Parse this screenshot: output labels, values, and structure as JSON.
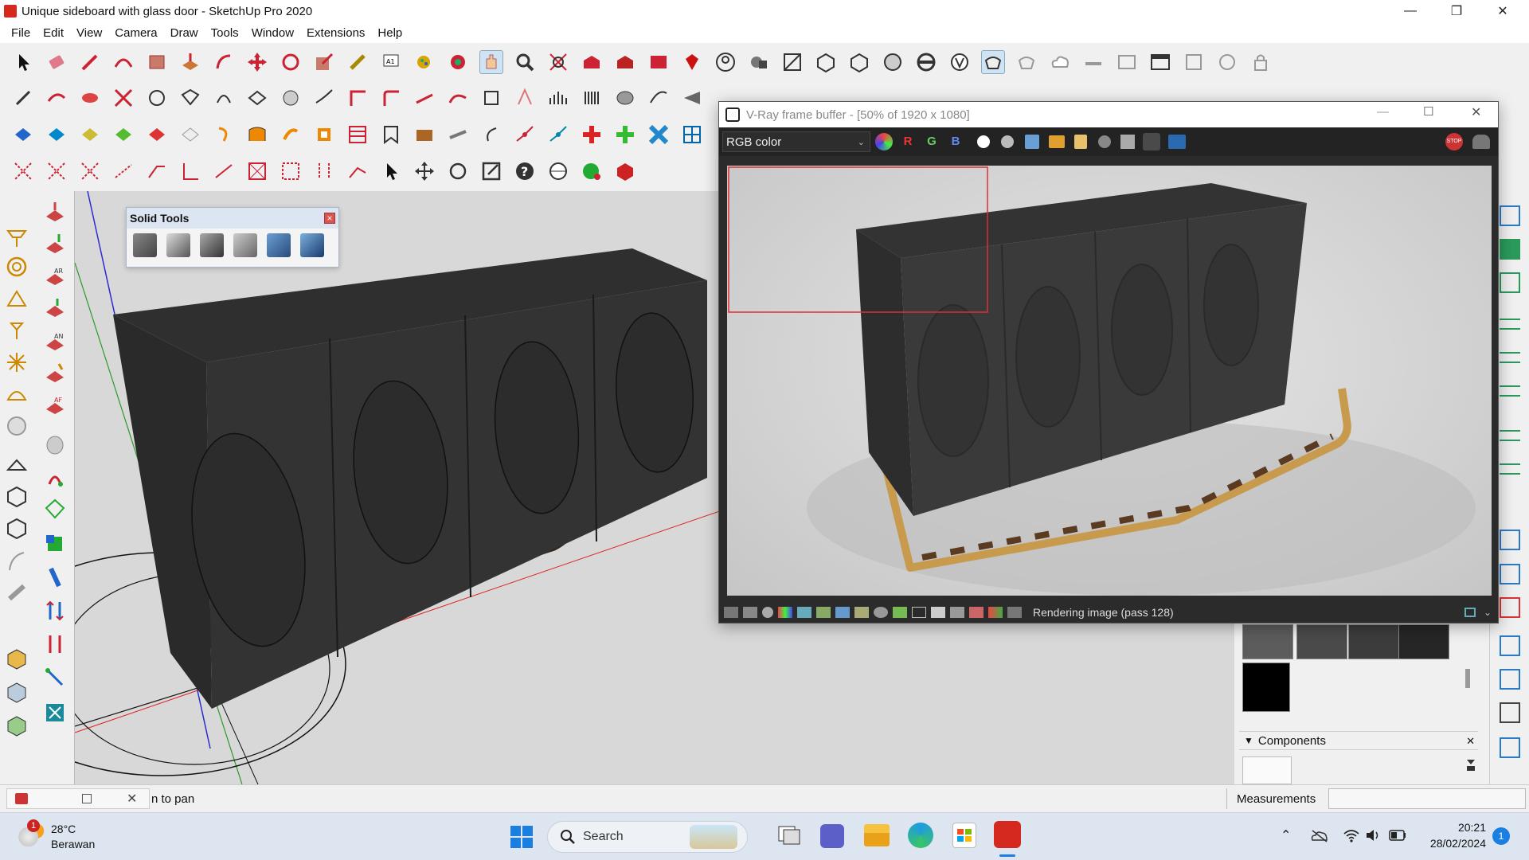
{
  "window": {
    "title": "Unique sideboard with glass door - SketchUp Pro 2020"
  },
  "menu": [
    "File",
    "Edit",
    "View",
    "Camera",
    "Draw",
    "Tools",
    "Window",
    "Extensions",
    "Help"
  ],
  "solid_tools": {
    "title": "Solid Tools",
    "close": "×"
  },
  "vray": {
    "title": "V-Ray frame buffer - [50% of 1920 x 1080]",
    "channel": "RGB color",
    "r": "R",
    "g": "G",
    "b": "B",
    "status": "Rendering image (pass 128)"
  },
  "panels": {
    "components_title": "Components",
    "measurements_label": "Measurements"
  },
  "statusbar": {
    "hint": "n to pan"
  },
  "taskbar": {
    "weather_temp": "28°C",
    "weather_desc": "Berawan",
    "weather_badge": "1",
    "search_label": "Search",
    "time": "20:21",
    "date": "28/02/2024",
    "notification_count": "1"
  },
  "colors": {
    "accent": "#d5281e",
    "vray_bg": "#2b2b2b",
    "selection_red": "#e03030",
    "taskbar": "#dde6f0"
  }
}
